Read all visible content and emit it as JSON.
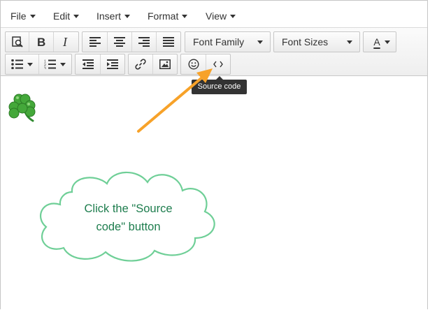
{
  "menubar": {
    "items": [
      {
        "label": "File"
      },
      {
        "label": "Edit"
      },
      {
        "label": "Insert"
      },
      {
        "label": "Format"
      },
      {
        "label": "View"
      }
    ]
  },
  "toolbar": {
    "font_family": "Font Family",
    "font_sizes": "Font Sizes",
    "text_color_glyph": "A"
  },
  "tooltip": {
    "text": "Source code"
  },
  "callout": {
    "line1": "Click the \"Source",
    "line2": "code\" button"
  },
  "colors": {
    "arrow": "#f7a229",
    "callout_border": "#6fcf97",
    "callout_text": "#1e7d4e",
    "tooltip_bg": "#333333"
  }
}
